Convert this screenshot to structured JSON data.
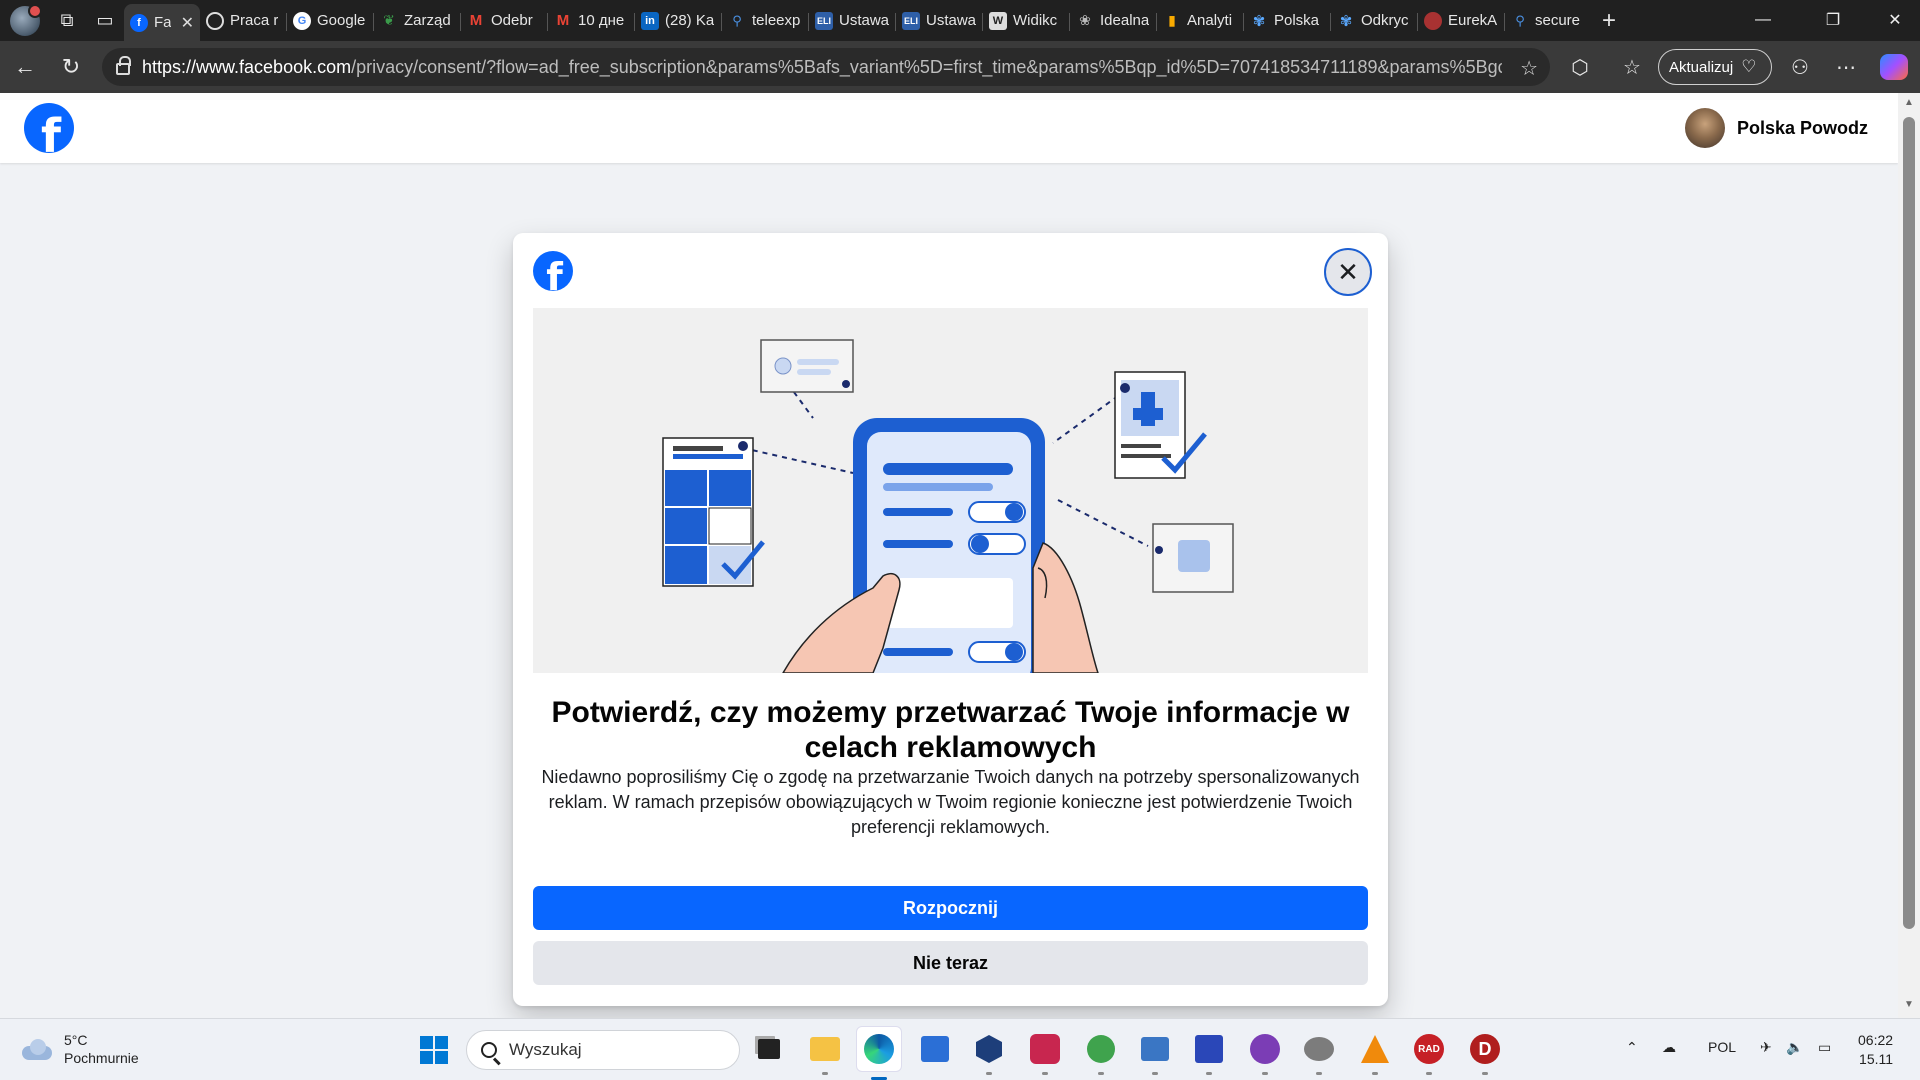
{
  "browser": {
    "tabs": [
      {
        "label": "Fa",
        "favicon": "facebook-icon",
        "active": true
      },
      {
        "label": "Praca r",
        "favicon": "globe-icon"
      },
      {
        "label": "Google",
        "favicon": "google-icon"
      },
      {
        "label": "Zarząd",
        "favicon": "leaf-icon"
      },
      {
        "label": "Odebr",
        "favicon": "gmail-icon"
      },
      {
        "label": "10 дне",
        "favicon": "gmail-icon"
      },
      {
        "label": "(28) Ka",
        "favicon": "linkedin-icon"
      },
      {
        "label": "teleexp",
        "favicon": "search-icon"
      },
      {
        "label": "Ustawa",
        "favicon": "eli-icon"
      },
      {
        "label": "Ustawa",
        "favicon": "eli-icon"
      },
      {
        "label": "Widikc",
        "favicon": "wiki-icon"
      },
      {
        "label": "Idealna",
        "favicon": "cat-icon"
      },
      {
        "label": "Analyti",
        "favicon": "analytics-icon"
      },
      {
        "label": "Polska",
        "favicon": "butterfly-icon"
      },
      {
        "label": "Odkryc",
        "favicon": "butterfly-icon"
      },
      {
        "label": "EurekA",
        "favicon": "eureka-icon"
      },
      {
        "label": "secure",
        "favicon": "search-icon"
      }
    ],
    "url_host": "https://www.facebook.com",
    "url_path": "/privacy/consent/?flow=ad_free_subscription&params%5Bafs_variant%5D=first_time&params%5Bqp_id%5D=707418534711189&params%5Bgcl_ex...",
    "update_label": "Aktualizuj"
  },
  "header": {
    "user_name": "Polska Powodz"
  },
  "modal": {
    "title": "Potwierdź, czy możemy przetwarzać Twoje informacje w celach reklamowych",
    "text": "Niedawno poprosiliśmy Cię o zgodę na przetwarzanie Twoich danych na potrzeby spersonalizowanych reklam. W ramach przepisów obowiązujących w Twoim regionie konieczne jest potwierdzenie Twoich preferencji reklamowych.",
    "primary_label": "Rozpocznij",
    "secondary_label": "Nie teraz"
  },
  "taskbar": {
    "temp": "5°C",
    "weather": "Pochmurnie",
    "search_placeholder": "Wyszukaj",
    "lang": "POL",
    "time": "06:22",
    "date": "15.11"
  },
  "colors": {
    "fb_blue": "#0866ff",
    "page_bg": "#f0f2f5",
    "secondary_btn": "#e4e6eb"
  }
}
